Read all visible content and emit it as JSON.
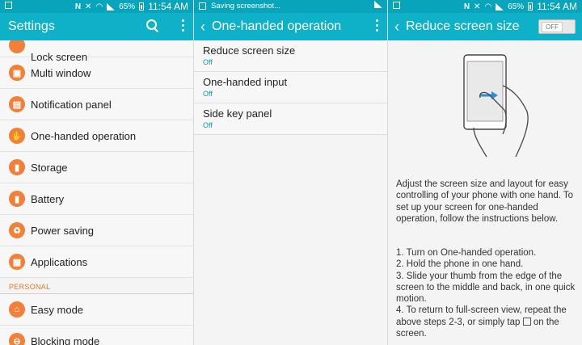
{
  "status": {
    "battery": "65%",
    "time": "11:54 AM",
    "saving_text": "Saving screenshot..."
  },
  "settings": {
    "title": "Settings",
    "partial_top_label": "Lock screen",
    "items": [
      {
        "label": "Multi window",
        "icon": "multi-window-icon"
      },
      {
        "label": "Notification panel",
        "icon": "notification-panel-icon"
      },
      {
        "label": "One-handed operation",
        "icon": "one-handed-icon"
      },
      {
        "label": "Storage",
        "icon": "storage-icon"
      },
      {
        "label": "Battery",
        "icon": "battery-icon"
      },
      {
        "label": "Power saving",
        "icon": "power-saving-icon"
      },
      {
        "label": "Applications",
        "icon": "applications-icon"
      }
    ],
    "section_personal": "PERSONAL",
    "personal_items": [
      {
        "label": "Easy mode",
        "icon": "easy-mode-icon"
      },
      {
        "label": "Blocking mode",
        "icon": "blocking-mode-icon"
      }
    ]
  },
  "one_handed": {
    "title": "One-handed operation",
    "items": [
      {
        "title": "Reduce screen size",
        "state": "Off"
      },
      {
        "title": "One-handed input",
        "state": "Off"
      },
      {
        "title": "Side key panel",
        "state": "Off"
      }
    ]
  },
  "reduce": {
    "title": "Reduce screen size",
    "toggle": "OFF",
    "description": "Adjust the screen size and layout for easy controlling of your phone with one hand. To set up your screen for one-handed operation, follow the instructions below.",
    "step1": "1. Turn on One-handed operation.",
    "step2": "2. Hold the phone in one hand.",
    "step3": "3. Slide your thumb from the edge of the screen to the middle and back, in one quick motion.",
    "step4_a": "4. To return to full-screen view, repeat the above steps 2-3, or simply tap",
    "step4_b": "on the screen."
  },
  "colors": {
    "statusbar": "#08a4bb",
    "appbar": "#0fb1c8",
    "icon_orange": "#f0803a",
    "state_teal": "#0a98ac",
    "section_orange": "#e07a2a"
  }
}
